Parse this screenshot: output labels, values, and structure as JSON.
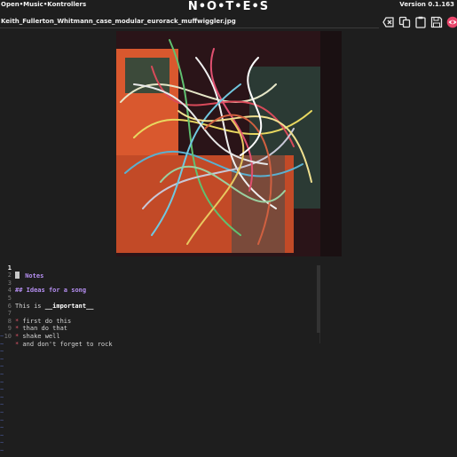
{
  "header": {
    "app_name": "Open•Music•Kontrollers",
    "title": "N•O•T•E•S",
    "version": "Version 0.1.163"
  },
  "file": {
    "name": "Keith_Fullerton_Whitmann_case_modular_eurorack_muffwiggler.jpg"
  },
  "toolbar": {
    "buttons": [
      {
        "name": "clear-icon",
        "color": "#e6e6e6"
      },
      {
        "name": "copy-icon",
        "color": "#e6e6e6"
      },
      {
        "name": "paste-icon",
        "color": "#e6e6e6"
      },
      {
        "name": "save-icon",
        "color": "#e6e6e6"
      },
      {
        "name": "preview-eye-icon",
        "color": "#e8456a"
      }
    ]
  },
  "editor": {
    "lines": [
      {
        "n": "1",
        "marks": "#",
        "text": " Notes"
      },
      {
        "n": "2",
        "text": ""
      },
      {
        "n": "3",
        "marks": "##",
        "text": " Ideas for a song"
      },
      {
        "n": "4",
        "text": ""
      },
      {
        "n": "5",
        "pre": "This is ",
        "bold": "__important__"
      },
      {
        "n": "6",
        "text": ""
      },
      {
        "n": "7",
        "bullet": "*",
        "text": " first do this"
      },
      {
        "n": "8",
        "bullet": "*",
        "text": " than do that"
      },
      {
        "n": "9",
        "bullet": "*",
        "text": " shake well"
      },
      {
        "n": "10",
        "bullet": "*",
        "text": " and don't forget to rock"
      }
    ],
    "empty_marker": "~"
  },
  "colors": {
    "background": "#1e1e1e",
    "heading": "#b48ef0",
    "bullet": "#e0566a",
    "eye_accent": "#e8456a",
    "photo_frame": "#e8643a"
  }
}
